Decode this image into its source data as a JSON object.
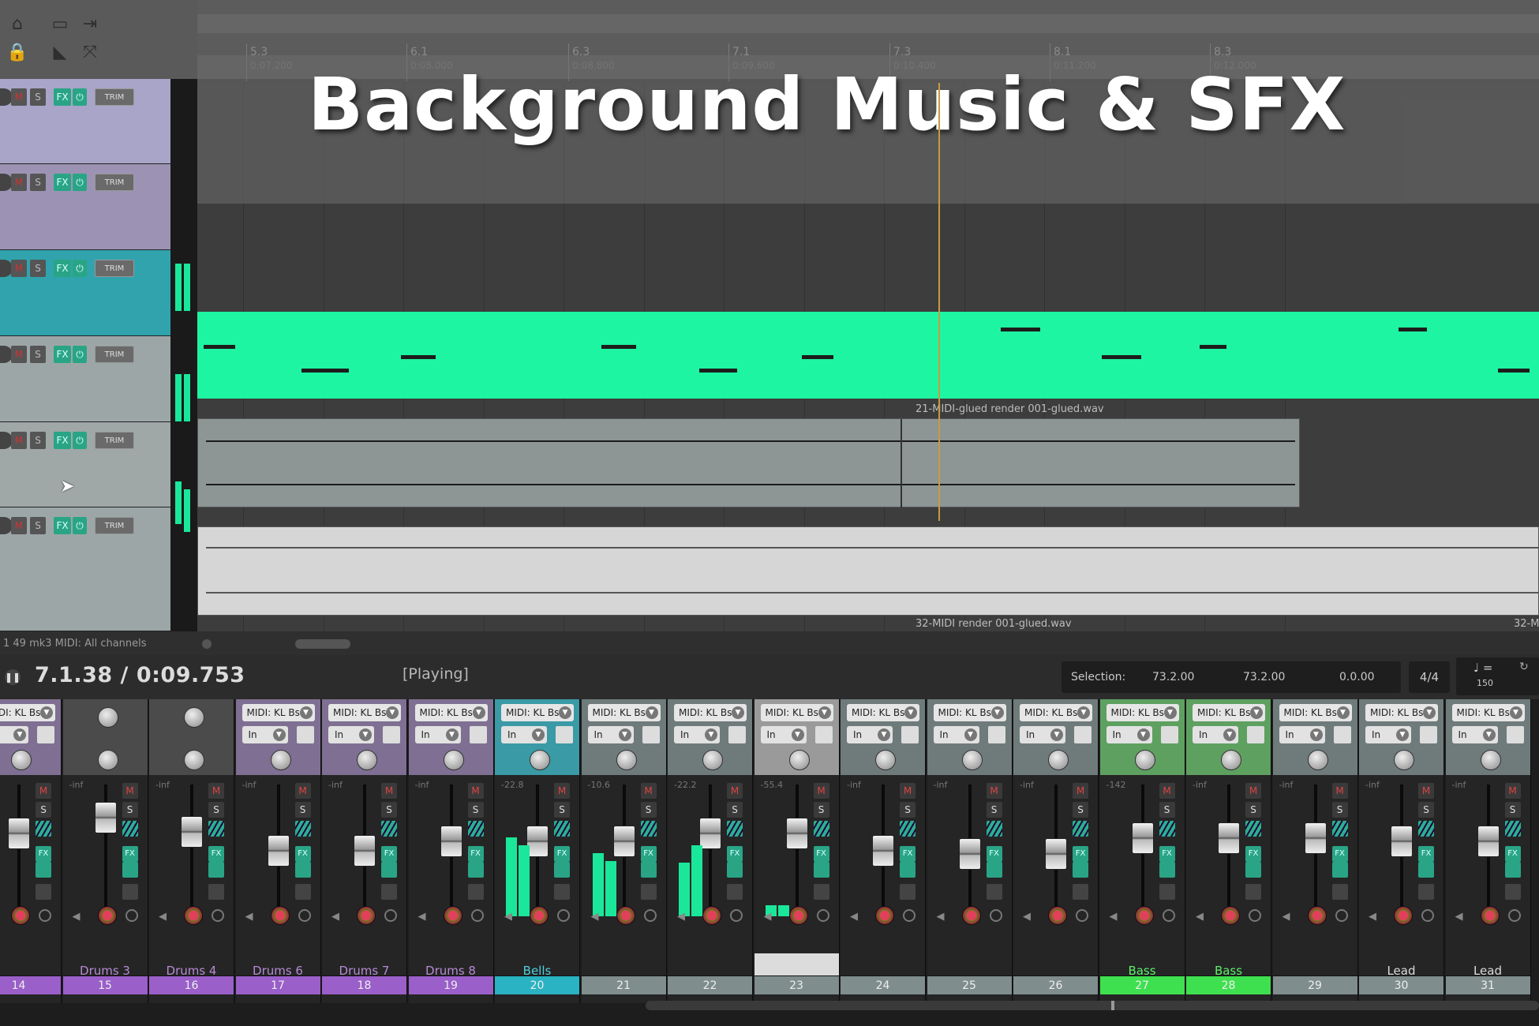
{
  "title_overlay": "Background Music & SFX",
  "ruler": {
    "markers": [
      {
        "label": "5.3",
        "sub": "0:07.200"
      },
      {
        "label": "6.1",
        "sub": "0:08.000"
      },
      {
        "label": "6.3",
        "sub": "0:08.800"
      },
      {
        "label": "7.1",
        "sub": "0:09.600"
      },
      {
        "label": "7.3",
        "sub": "0:10.400"
      },
      {
        "label": "8.1",
        "sub": "0:11.200"
      },
      {
        "label": "8.3",
        "sub": "0:12.000"
      }
    ]
  },
  "tcp": {
    "buttons": {
      "mute": "M",
      "solo": "S",
      "fx": "FX",
      "power": "⏻",
      "trim": "TRIM"
    }
  },
  "items": {
    "audio1_label": "21-MIDI-glued render 001-glued.wav",
    "audio2_label": "32-MIDI render 001-glued.wav",
    "audio2_label_right": "32-M"
  },
  "status_lane": {
    "text": "1 49 mk3 MIDI: All channels"
  },
  "transport": {
    "position": "7.1.38 / 0:09.753",
    "state": "[Playing]",
    "selection_label": "Selection:",
    "sel_start": "73.2.00",
    "sel_end": "73.2.00",
    "sel_length": "0.0.00",
    "time_signature": "4/4",
    "tempo": "150"
  },
  "mixer": {
    "midi_label": "MIDI: KL Bs",
    "in_label": "In",
    "mute": "M",
    "solo": "S",
    "fx": "FX",
    "strips": [
      {
        "num": "14",
        "name": "",
        "db": "-inf",
        "color": "#9a5fc9",
        "top": "#7f6f93",
        "fader": 30,
        "hasmidi": true,
        "meters": []
      },
      {
        "num": "15",
        "name": "Drums 3",
        "db": "-inf",
        "color": "#9a5fc9",
        "top": "#4b4b4b",
        "fader": 10,
        "hasmidi": false,
        "meters": []
      },
      {
        "num": "16",
        "name": "Drums 4",
        "db": "-inf",
        "color": "#9a5fc9",
        "top": "#4b4b4b",
        "fader": 28,
        "hasmidi": false,
        "meters": []
      },
      {
        "num": "17",
        "name": "Drums 6",
        "db": "-inf",
        "color": "#9a5fc9",
        "top": "#7f6f93",
        "fader": 52,
        "hasmidi": true,
        "meters": []
      },
      {
        "num": "18",
        "name": "Drums 7",
        "db": "-inf",
        "color": "#9a5fc9",
        "top": "#7f6f93",
        "fader": 52,
        "hasmidi": true,
        "meters": []
      },
      {
        "num": "19",
        "name": "Drums 8",
        "db": "-inf",
        "color": "#9a5fc9",
        "top": "#7f6f93",
        "fader": 40,
        "hasmidi": true,
        "meters": []
      },
      {
        "num": "20",
        "name": "Bells",
        "db": "-22.8",
        "color": "#2ab3c2",
        "top": "#3a9aa6",
        "fader": 40,
        "hasmidi": true,
        "meters": [
          100,
          90
        ]
      },
      {
        "num": "21",
        "name": "",
        "db": "-10.6",
        "color": "#7f8d8d",
        "top": "#6f7b7b",
        "fader": 40,
        "hasmidi": true,
        "meters": [
          80,
          70
        ]
      },
      {
        "num": "22",
        "name": "",
        "db": "-22.2",
        "color": "#7f8d8d",
        "top": "#6f7b7b",
        "fader": 30,
        "hasmidi": true,
        "meters": [
          68,
          90
        ]
      },
      {
        "num": "23",
        "name": "",
        "db": "-55.4",
        "color": "#7f8d8d",
        "top": "#9a9a9a",
        "fader": 30,
        "hasmidi": true,
        "meters": [
          14,
          14
        ]
      },
      {
        "num": "24",
        "name": "",
        "db": "-inf",
        "color": "#7f8d8d",
        "top": "#6f7b7b",
        "fader": 52,
        "hasmidi": true,
        "meters": []
      },
      {
        "num": "25",
        "name": "",
        "db": "-inf",
        "color": "#7f8d8d",
        "top": "#6f7b7b",
        "fader": 56,
        "hasmidi": true,
        "meters": []
      },
      {
        "num": "26",
        "name": "",
        "db": "-inf",
        "color": "#7f8d8d",
        "top": "#6f7b7b",
        "fader": 56,
        "hasmidi": true,
        "meters": []
      },
      {
        "num": "27",
        "name": "Bass",
        "db": "-142",
        "color": "#3fe04f",
        "top": "#5ea060",
        "fader": 36,
        "hasmidi": true,
        "meters": []
      },
      {
        "num": "28",
        "name": "Bass",
        "db": "-inf",
        "color": "#3fe04f",
        "top": "#5ea060",
        "fader": 36,
        "hasmidi": true,
        "meters": []
      },
      {
        "num": "29",
        "name": "",
        "db": "-inf",
        "color": "#7f8d8d",
        "top": "#6f7b7b",
        "fader": 36,
        "hasmidi": true,
        "meters": []
      },
      {
        "num": "30",
        "name": "Lead",
        "db": "-inf",
        "color": "#7f8d8d",
        "top": "#6f7b7b",
        "fader": 40,
        "hasmidi": true,
        "meters": []
      },
      {
        "num": "31",
        "name": "Lead",
        "db": "-inf",
        "color": "#7f8d8d",
        "top": "#6f7b7b",
        "fader": 40,
        "hasmidi": true,
        "meters": []
      }
    ]
  },
  "colors": {
    "midi_item": "#1ef5a2",
    "audio_item_dark": "#8d9595",
    "audio_item_light": "#d6d6d6",
    "playhead": "#c79a45",
    "track1": "#a8a5c8",
    "track2": "#9c93b4",
    "track3": "#30a3ad",
    "track4": "#9da6a6",
    "track5": "#9fa7a7"
  }
}
